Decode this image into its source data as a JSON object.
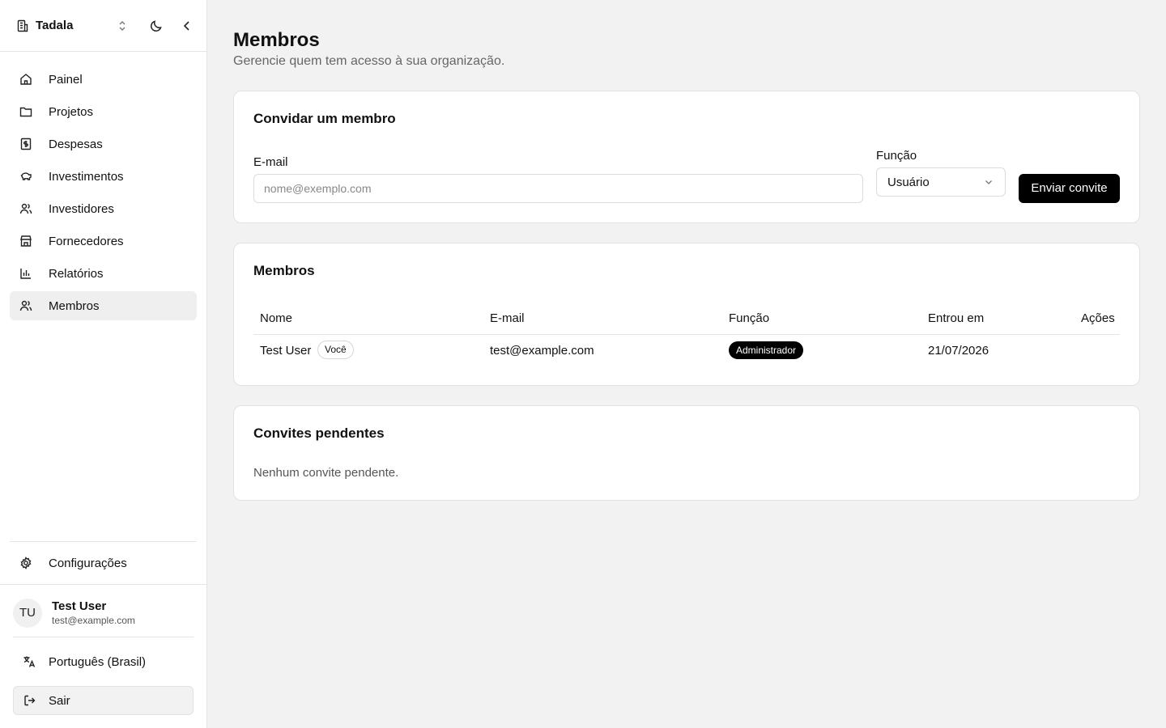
{
  "sidebar": {
    "org_name": "Tadala",
    "items": [
      {
        "label": "Painel",
        "icon": "home-icon"
      },
      {
        "label": "Projetos",
        "icon": "folder-icon"
      },
      {
        "label": "Despesas",
        "icon": "receipt-icon"
      },
      {
        "label": "Investimentos",
        "icon": "piggy-bank-icon"
      },
      {
        "label": "Investidores",
        "icon": "users-icon"
      },
      {
        "label": "Fornecedores",
        "icon": "store-icon"
      },
      {
        "label": "Relatórios",
        "icon": "bar-chart-icon"
      },
      {
        "label": "Membros",
        "icon": "users-icon",
        "active": true
      }
    ],
    "settings_label": "Configurações",
    "user": {
      "initials": "TU",
      "name": "Test User",
      "email": "test@example.com"
    },
    "language_label": "Português (Brasil)",
    "logout_label": "Sair"
  },
  "main": {
    "title": "Membros",
    "subtitle": "Gerencie quem tem acesso à sua organização.",
    "invite": {
      "title": "Convidar um membro",
      "email_label": "E-mail",
      "email_placeholder": "nome@exemplo.com",
      "email_value": "",
      "role_label": "Função",
      "role_value": "Usuário",
      "submit_label": "Enviar convite"
    },
    "members": {
      "title": "Membros",
      "columns": [
        "Nome",
        "E-mail",
        "Função",
        "Entrou em",
        "Ações"
      ],
      "rows": [
        {
          "name": "Test User",
          "you_badge": "Você",
          "email": "test@example.com",
          "role": "Administrador",
          "joined": "21/07/2026"
        }
      ]
    },
    "pending": {
      "title": "Convites pendentes",
      "empty_text": "Nenhum convite pendente."
    }
  }
}
